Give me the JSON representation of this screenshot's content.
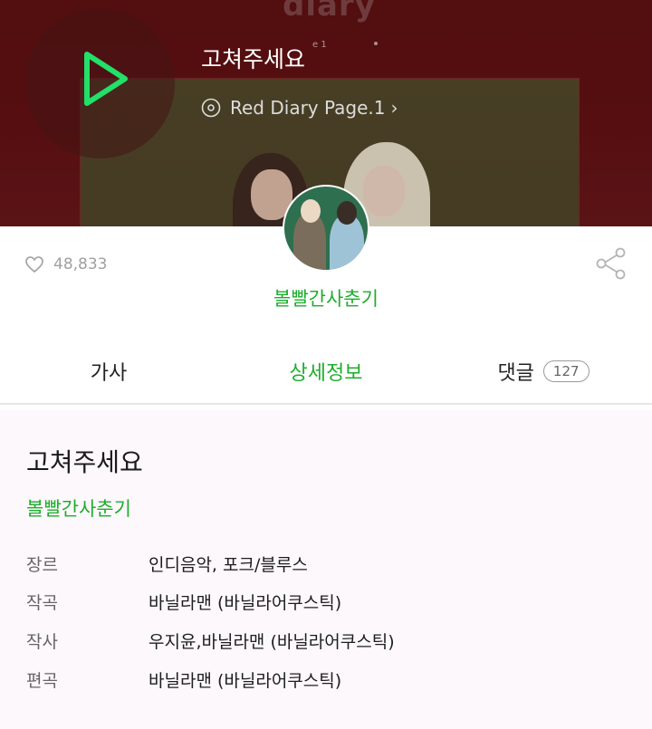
{
  "player": {
    "song_title": "고쳐주세요",
    "album_name": "Red Diary Page.1",
    "album_chevron": "›",
    "cover_word": "diary",
    "cover_sub": "e 1"
  },
  "stats": {
    "like_count": "48,833"
  },
  "artist": {
    "name": "볼빨간사춘기"
  },
  "tabs": [
    {
      "label": "가사",
      "active": false
    },
    {
      "label": "상세정보",
      "active": true
    },
    {
      "label": "댓글",
      "active": false,
      "badge": "127"
    }
  ],
  "details": {
    "title": "고쳐주세요",
    "artist": "볼빨간사춘기",
    "rows": [
      {
        "label": "장르",
        "value": "인디음악, 포크/블루스"
      },
      {
        "label": "작곡",
        "value": "바닐라맨 (바닐라어쿠스틱)"
      },
      {
        "label": "작사",
        "value": "우지윤,바닐라맨 (바닐라어쿠스틱)"
      },
      {
        "label": "편곡",
        "value": "바닐라맨 (바닐라어쿠스틱)"
      }
    ]
  },
  "colors": {
    "accent": "#1fad2c",
    "hero_bg": "#5a1012",
    "text_primary": "#1b1b1b",
    "text_secondary": "#666666"
  },
  "icons": {
    "play": "play-icon",
    "disc": "disc-icon",
    "heart": "heart-icon",
    "share": "share-icon"
  }
}
